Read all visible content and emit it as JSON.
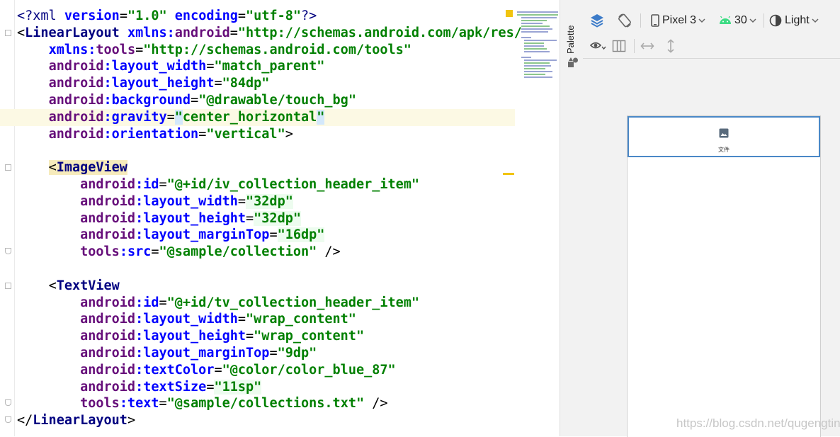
{
  "editor": {
    "lines": [
      {
        "indent": "",
        "tokens": [
          [
            "t-pi",
            "<?"
          ],
          [
            "t-pi",
            "xml "
          ],
          [
            "t-attr",
            "version"
          ],
          [
            "t-punct",
            "="
          ],
          [
            "t-val",
            "\"1.0\""
          ],
          [
            "t-punct",
            " "
          ],
          [
            "t-attr",
            "encoding"
          ],
          [
            "t-punct",
            "="
          ],
          [
            "t-val",
            "\"utf-8\""
          ],
          [
            "t-pi",
            "?>"
          ]
        ]
      },
      {
        "indent": "",
        "tokens": [
          [
            "t-punct",
            "<"
          ],
          [
            "t-tag",
            "LinearLayout"
          ],
          [
            "t-punct",
            " "
          ],
          [
            "t-attr",
            "xmlns:"
          ],
          [
            "t-ns",
            "android"
          ],
          [
            "t-punct",
            "="
          ],
          [
            "t-val",
            "\"http://schemas.android.com/apk/res/"
          ]
        ]
      },
      {
        "indent": "    ",
        "tokens": [
          [
            "t-attr",
            "xmlns:"
          ],
          [
            "t-ns",
            "tools"
          ],
          [
            "t-punct",
            "="
          ],
          [
            "t-val",
            "\"http://schemas.android.com/tools\""
          ]
        ]
      },
      {
        "indent": "    ",
        "tokens": [
          [
            "t-ns",
            "android"
          ],
          [
            "t-attr",
            ":layout_width"
          ],
          [
            "t-punct",
            "="
          ],
          [
            "t-val",
            "\"match_parent\""
          ]
        ]
      },
      {
        "indent": "    ",
        "tokens": [
          [
            "t-ns",
            "android"
          ],
          [
            "t-attr",
            ":layout_height"
          ],
          [
            "t-punct",
            "="
          ],
          [
            "t-val",
            "\"84dp\""
          ]
        ]
      },
      {
        "indent": "    ",
        "tokens": [
          [
            "t-ns",
            "android"
          ],
          [
            "t-attr",
            ":background"
          ],
          [
            "t-punct",
            "="
          ],
          [
            "t-val",
            "\"@drawable/touch_bg\""
          ]
        ]
      },
      {
        "indent": "    ",
        "current": true,
        "tokens": [
          [
            "t-ns",
            "android"
          ],
          [
            "t-attr",
            ":gravity"
          ],
          [
            "t-punct",
            "="
          ],
          [
            "t-val caretsel",
            "\""
          ],
          [
            "t-val",
            "center_horizontal"
          ],
          [
            "t-val caretsel",
            "\""
          ]
        ]
      },
      {
        "indent": "    ",
        "tokens": [
          [
            "t-ns",
            "android"
          ],
          [
            "t-attr",
            ":orientation"
          ],
          [
            "t-punct",
            "="
          ],
          [
            "t-val",
            "\"vertical\""
          ],
          [
            "t-punct",
            ">"
          ]
        ]
      },
      {
        "indent": "",
        "tokens": []
      },
      {
        "indent": "    ",
        "tokens": [
          [
            "t-punct hl-tag",
            "<"
          ],
          [
            "t-tag hl-tag",
            "ImageView"
          ]
        ]
      },
      {
        "indent": "        ",
        "tokens": [
          [
            "t-ns",
            "android"
          ],
          [
            "t-attr",
            ":id"
          ],
          [
            "t-punct",
            "="
          ],
          [
            "t-val",
            "\"@+id/iv_collection_header_item\""
          ]
        ]
      },
      {
        "indent": "        ",
        "tokens": [
          [
            "t-ns",
            "android"
          ],
          [
            "t-attr",
            ":layout_width"
          ],
          [
            "t-punct",
            "="
          ],
          [
            "t-val hl-val",
            "\"32dp\""
          ]
        ]
      },
      {
        "indent": "        ",
        "tokens": [
          [
            "t-ns",
            "android"
          ],
          [
            "t-attr",
            ":layout_height"
          ],
          [
            "t-punct",
            "="
          ],
          [
            "t-val hl-val",
            "\"32dp\""
          ]
        ]
      },
      {
        "indent": "        ",
        "tokens": [
          [
            "t-ns",
            "android"
          ],
          [
            "t-attr",
            ":layout_marginTop"
          ],
          [
            "t-punct",
            "="
          ],
          [
            "t-val hl-val",
            "\"16dp\""
          ]
        ]
      },
      {
        "indent": "        ",
        "tokens": [
          [
            "t-ns",
            "tools"
          ],
          [
            "t-attr",
            ":src"
          ],
          [
            "t-punct",
            "="
          ],
          [
            "t-val",
            "\"@sample/collection\""
          ],
          [
            "t-punct",
            " />"
          ]
        ]
      },
      {
        "indent": "",
        "tokens": []
      },
      {
        "indent": "    ",
        "tokens": [
          [
            "t-punct",
            "<"
          ],
          [
            "t-tag",
            "TextView"
          ]
        ]
      },
      {
        "indent": "        ",
        "tokens": [
          [
            "t-ns",
            "android"
          ],
          [
            "t-attr",
            ":id"
          ],
          [
            "t-punct",
            "="
          ],
          [
            "t-val",
            "\"@+id/tv_collection_header_item\""
          ]
        ]
      },
      {
        "indent": "        ",
        "tokens": [
          [
            "t-ns",
            "android"
          ],
          [
            "t-attr",
            ":layout_width"
          ],
          [
            "t-punct",
            "="
          ],
          [
            "t-val",
            "\"wrap_content\""
          ]
        ]
      },
      {
        "indent": "        ",
        "tokens": [
          [
            "t-ns",
            "android"
          ],
          [
            "t-attr",
            ":layout_height"
          ],
          [
            "t-punct",
            "="
          ],
          [
            "t-val",
            "\"wrap_content\""
          ]
        ]
      },
      {
        "indent": "        ",
        "tokens": [
          [
            "t-ns",
            "android"
          ],
          [
            "t-attr",
            ":layout_marginTop"
          ],
          [
            "t-punct",
            "="
          ],
          [
            "t-val",
            "\"9dp\""
          ]
        ]
      },
      {
        "indent": "        ",
        "tokens": [
          [
            "t-ns",
            "android"
          ],
          [
            "t-attr",
            ":textColor"
          ],
          [
            "t-punct",
            "="
          ],
          [
            "t-val",
            "\"@color/color_blue_87\""
          ]
        ]
      },
      {
        "indent": "        ",
        "tokens": [
          [
            "t-ns",
            "android"
          ],
          [
            "t-attr",
            ":textSize"
          ],
          [
            "t-punct",
            "="
          ],
          [
            "t-val hl-val",
            "\"11sp\""
          ]
        ]
      },
      {
        "indent": "        ",
        "tokens": [
          [
            "t-ns",
            "tools"
          ],
          [
            "t-attr",
            ":text"
          ],
          [
            "t-punct",
            "="
          ],
          [
            "t-val",
            "\"@sample/collections.txt\""
          ],
          [
            "t-punct",
            " />"
          ]
        ]
      },
      {
        "indent": "",
        "tokens": [
          [
            "t-punct",
            "</"
          ],
          [
            "t-tag",
            "LinearLayout"
          ],
          [
            "t-punct",
            ">"
          ]
        ]
      }
    ]
  },
  "palette": {
    "label": "Palette"
  },
  "design_toolbar": {
    "device": "Pixel 3",
    "api_level": "30",
    "theme": "Light"
  },
  "preview": {
    "text_label": "文件"
  },
  "watermark": "https://blog.csdn.net/qugengting",
  "colors": {
    "selection_border": "#4a88c7",
    "android_green": "#3ddc84",
    "layers_blue": "#3d7cc9"
  }
}
